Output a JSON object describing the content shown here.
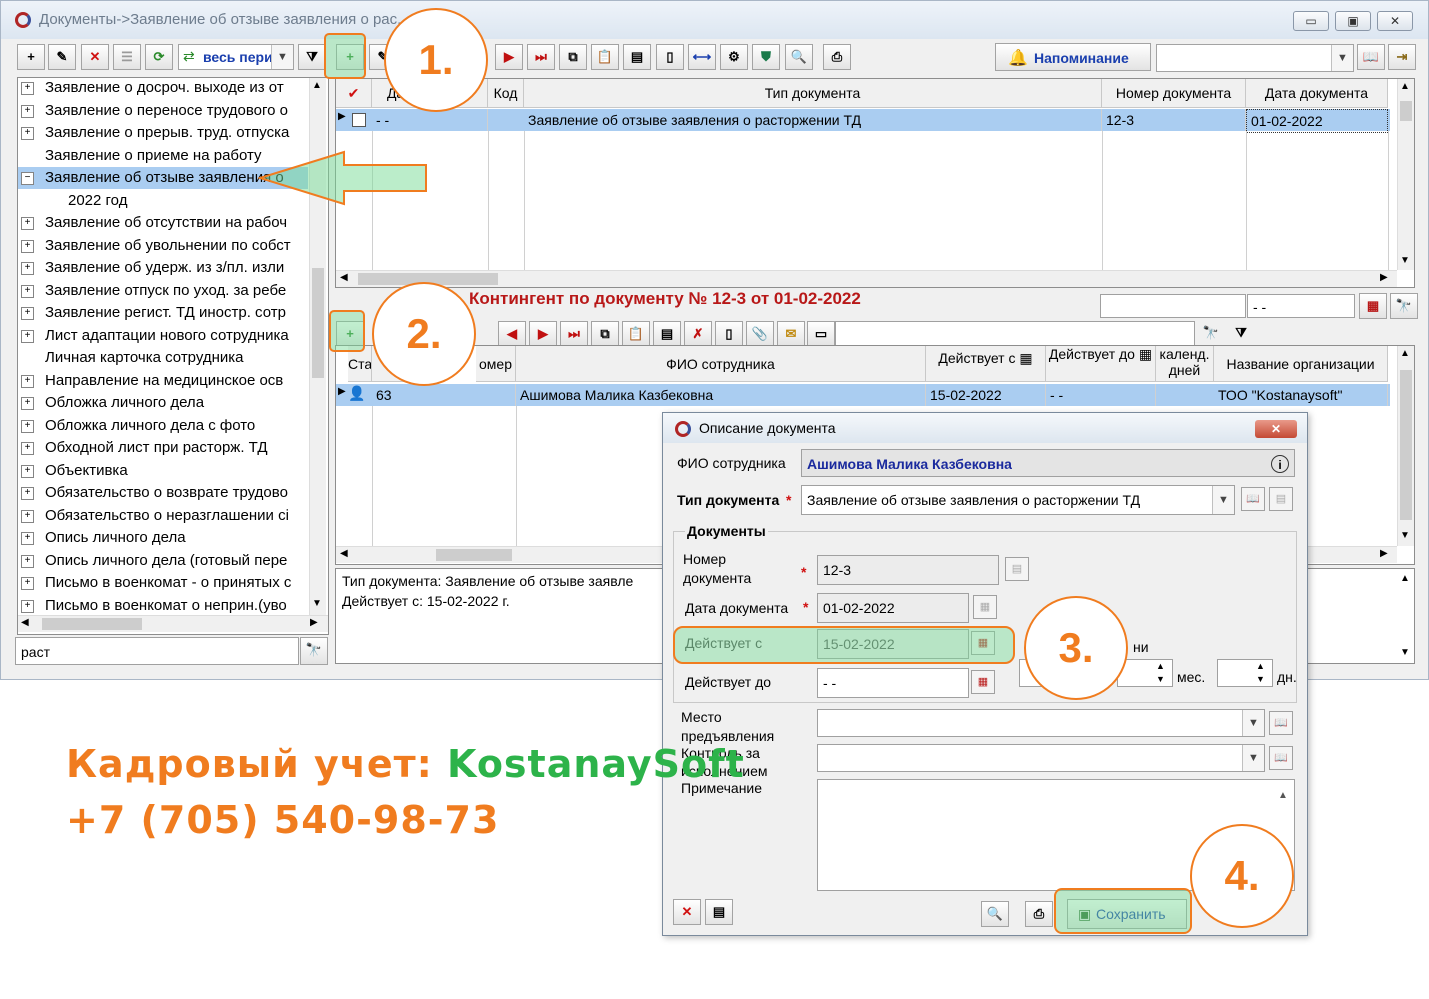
{
  "window": {
    "title": "Документы->Заявление об отзыве заявления о рас...",
    "controls": [
      "▭",
      "▣",
      "✕"
    ]
  },
  "toolbar": {
    "period_label": "весь пери",
    "reminder_label": "Напоминание"
  },
  "tree": {
    "items": [
      {
        "label": "Заявление о досроч. выходе из от",
        "expander": "+"
      },
      {
        "label": "Заявление о переносе трудового о",
        "expander": "+"
      },
      {
        "label": "Заявление о прерыв. труд. отпуска",
        "expander": "+"
      },
      {
        "label": "Заявление о приеме на работу",
        "expander": ""
      },
      {
        "label": "Заявление об отзыве заявления о",
        "expander": "−"
      },
      {
        "label": "2022 год",
        "expander": ""
      },
      {
        "label": "Заявление об отсутствии на рабоч",
        "expander": "+"
      },
      {
        "label": "Заявление об увольнении по собст",
        "expander": "+"
      },
      {
        "label": "Заявление об удерж. из з/пл. изли",
        "expander": "+"
      },
      {
        "label": "Заявление отпуск по уход. за ребе",
        "expander": "+"
      },
      {
        "label": "Заявление регист. ТД иностр. сотр",
        "expander": "+"
      },
      {
        "label": "Лист адаптации нового сотрудника",
        "expander": "+"
      },
      {
        "label": "Личная карточка сотрудника",
        "expander": ""
      },
      {
        "label": "Направление на медицинское  осв",
        "expander": "+"
      },
      {
        "label": "Обложка личного дела",
        "expander": "+"
      },
      {
        "label": "Обложка личного дела с фото",
        "expander": "+"
      },
      {
        "label": "Обходной лист при расторж. ТД",
        "expander": "+"
      },
      {
        "label": "Объективка",
        "expander": "+"
      },
      {
        "label": "Обязательство о возврате трудово",
        "expander": "+"
      },
      {
        "label": "Обязательство о неразглашении сі",
        "expander": "+"
      },
      {
        "label": "Опись личного дела",
        "expander": "+"
      },
      {
        "label": "Опись личного дела (готовый пере",
        "expander": "+"
      },
      {
        "label": "Письмо в военкомат - о принятых с",
        "expander": "+"
      },
      {
        "label": "Письмо в военкомат о неприн.(уво",
        "expander": "+"
      }
    ],
    "search_value": "раст"
  },
  "docs_grid": {
    "columns": [
      "Да",
      "о",
      "Код",
      "Тип документа",
      "Номер документа",
      "Дата документа"
    ],
    "rows": [
      {
        "date": "- -",
        "code": "",
        "type": "Заявление об отзыве заявления о расторжении ТД",
        "number": "12-3",
        "doc_date": "01-02-2022"
      }
    ]
  },
  "contingent": {
    "heading": "Контингент по документу № 12-3 от 01-02-2022",
    "date_filter": "- -",
    "columns": [
      "Ста",
      "Та",
      "омер",
      "ФИО сотрудника",
      "Действует с",
      "Действует до",
      "календ. дней",
      "Название организации"
    ],
    "rows": [
      {
        "num": "63",
        "fio": "Ашимова Малика Казбековна",
        "from": "15-02-2022",
        "to": "- -",
        "days": "",
        "org": "ТОО \"Kostanaysoft\""
      }
    ]
  },
  "info": {
    "line1": "Тип документа: Заявление об отзыве заявле",
    "line2": "Действует с: 15-02-2022 г."
  },
  "dialog": {
    "title": "Описание документа",
    "fio_label": "ФИО сотрудника",
    "fio_value": "Ашимова Малика Казбековна",
    "type_label": "Тип документа",
    "type_value": "Заявление об отзыве заявления о расторжении ТД",
    "group_label": "Документы",
    "number_label_1": "Номер",
    "number_label_2": "документа",
    "number_value": "12-3",
    "date_label": "Дата документа",
    "date_value": "01-02-2022",
    "from_label": "Действует с",
    "from_value": "15-02-2022",
    "to_label": "Действует до",
    "to_value": "- -",
    "days_label": "ни",
    "months_label": "мес.",
    "dn_label": "дн.",
    "place_label_1": "Место",
    "place_label_2": "предъявления",
    "control_label_1": "Контроль за",
    "control_label_2": "исполнением",
    "note_label": "Примечание",
    "save_label": "Сохранить"
  },
  "callouts": [
    "1.",
    "2.",
    "3.",
    "4."
  ],
  "promo": {
    "line1_prefix": "Кадровый учет: ",
    "line1_brand": "KostanaySoft",
    "line2": "+7 (705) 540-98-73",
    "orange": "#f07c1f",
    "green": "#2db34a"
  }
}
